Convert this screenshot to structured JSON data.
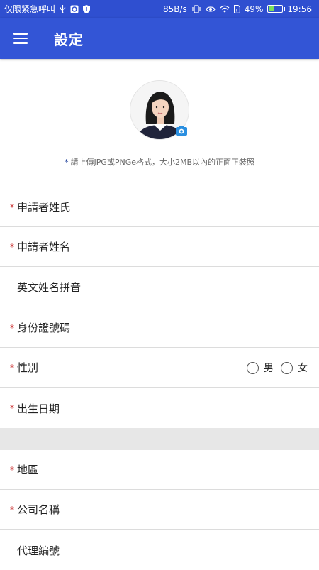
{
  "status_bar": {
    "carrier": "仅限紧急呼叫",
    "net_speed": "85B/s",
    "battery": "49%",
    "battery_level": 0.49,
    "time": "19:56"
  },
  "app_bar": {
    "title": "設定"
  },
  "photo": {
    "hint_star": "*",
    "hint": "請上傳JPG或PNGe格式，大小2MB以內的正面正裝照"
  },
  "form": {
    "surname": {
      "star": "*",
      "label": "申請者姓氏"
    },
    "given_name": {
      "star": "*",
      "label": "申請者姓名"
    },
    "english_name": {
      "label": "英文姓名拼音"
    },
    "id_number": {
      "star": "*",
      "label": "身份證號碼"
    },
    "gender": {
      "star": "*",
      "label": "性別",
      "male": "男",
      "female": "女"
    },
    "birth_date": {
      "star": "*",
      "label": "出生日期"
    },
    "region": {
      "star": "*",
      "label": "地區"
    },
    "company": {
      "star": "*",
      "label": "公司名稱"
    },
    "agent_no": {
      "label": "代理編號"
    }
  },
  "colors": {
    "primary": "#3355d6",
    "status_bar": "#2f4fd0",
    "required_star": "#c82828",
    "section_gap": "#e7e7e7"
  }
}
